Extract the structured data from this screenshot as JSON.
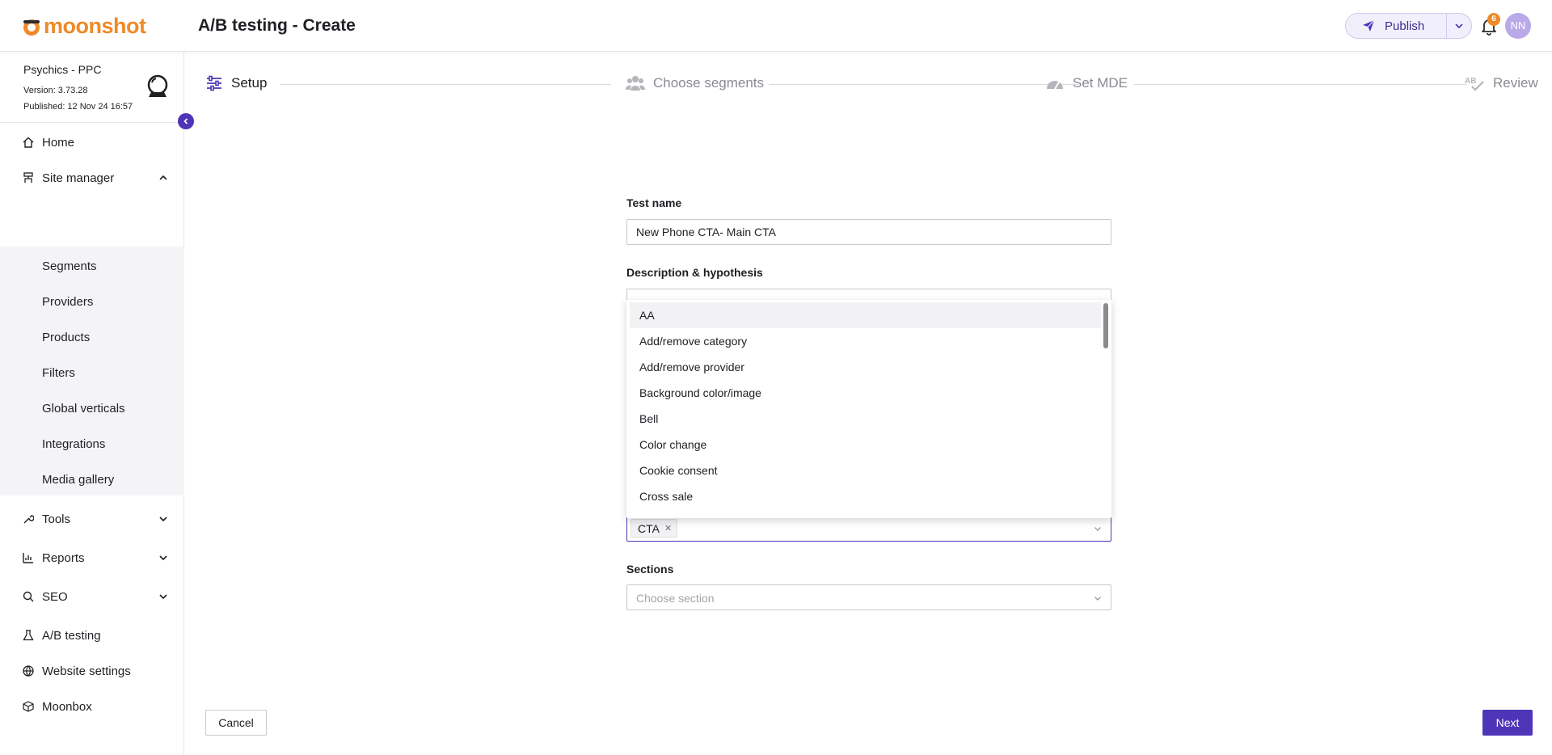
{
  "app": {
    "logo_text": "moonshot",
    "page_title": "A/B testing - Create"
  },
  "header": {
    "publish_label": "Publish",
    "notifications_count": "6",
    "avatar_initials": "NN"
  },
  "sidebar": {
    "site_name": "Psychics - PPC",
    "version": "Version: 3.73.28",
    "published": "Published: 12 Nov 24 16:57",
    "items": {
      "home": "Home",
      "site_manager": "Site manager",
      "tools": "Tools",
      "reports": "Reports",
      "seo": "SEO",
      "ab_testing": "A/B testing",
      "website_settings": "Website settings",
      "moonbox": "Moonbox"
    },
    "site_manager_sub": [
      "Segments",
      "Providers",
      "Products",
      "Filters",
      "Global verticals",
      "Integrations",
      "Media gallery"
    ]
  },
  "stepper": {
    "steps": [
      "Setup",
      "Choose segments",
      "Set MDE",
      "Review"
    ],
    "active_index": 0
  },
  "form": {
    "test_name_label": "Test name",
    "test_name_value": "New Phone CTA- Main CTA",
    "description_label": "Description & hypothesis",
    "tags_selected": [
      "CTA"
    ],
    "sections_label": "Sections",
    "sections_placeholder": "Choose section"
  },
  "dropdown": {
    "options": [
      "AA",
      "Add/remove category",
      "Add/remove provider",
      "Background color/image",
      "Bell",
      "Color change",
      "Cookie consent",
      "Cross sale"
    ],
    "highlighted_index": 0
  },
  "footer": {
    "cancel_label": "Cancel",
    "next_label": "Next"
  },
  "colors": {
    "brand_orange": "#ef8a28",
    "accent_purple": "#4e35b8",
    "publish_bg": "#f2effc"
  }
}
